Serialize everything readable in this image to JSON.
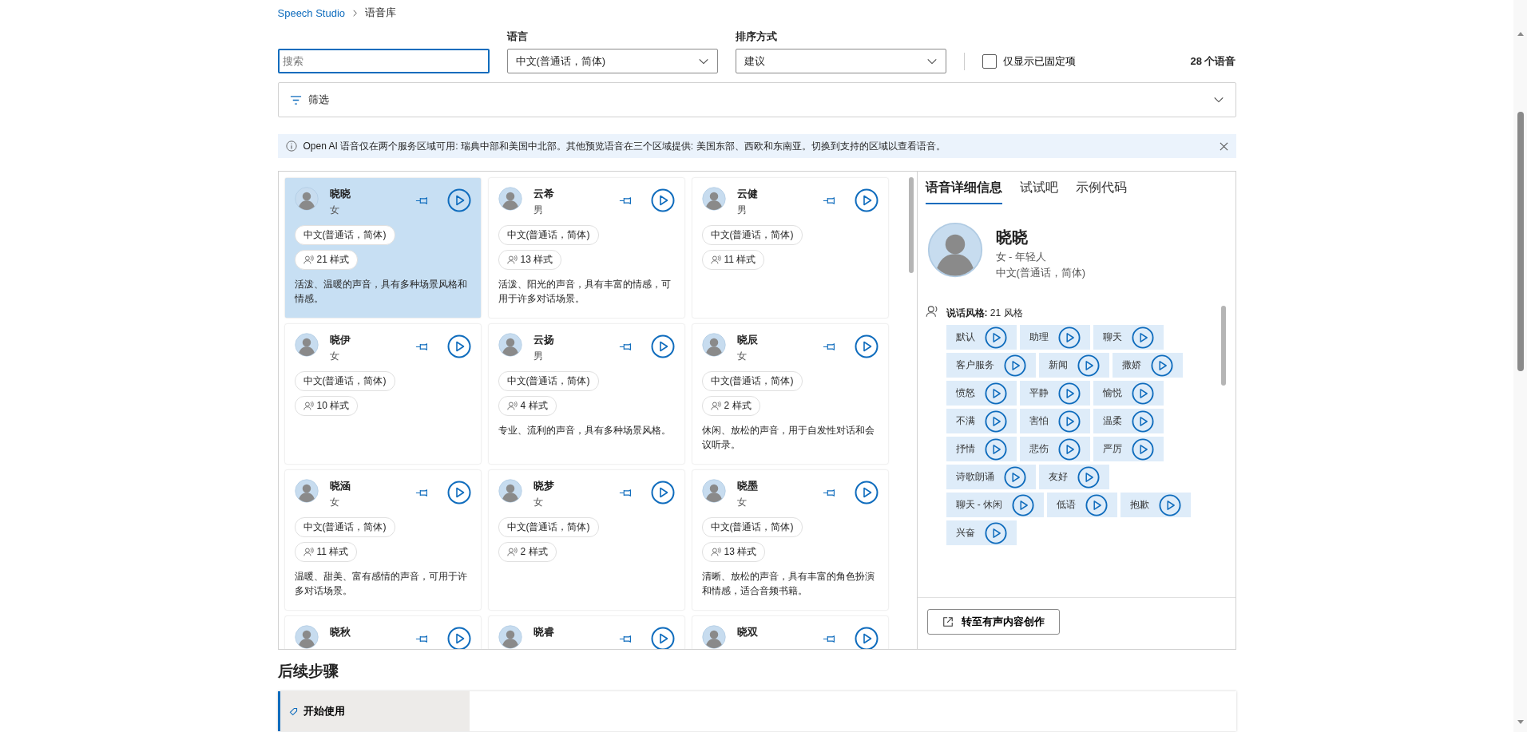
{
  "breadcrumb": [
    {
      "label": "Speech Studio",
      "kind": "link"
    },
    {
      "label": "语音库",
      "kind": "current"
    }
  ],
  "search": {
    "placeholder": "搜索"
  },
  "language_filter": {
    "label": "语言",
    "value": "中文(普通话，简体)"
  },
  "sort": {
    "label": "排序方式",
    "value": "建议"
  },
  "pinned_only": {
    "label": "仅显示已固定项",
    "checked": false
  },
  "voice_count": "28 个语音",
  "filter_panel": {
    "label": "筛选",
    "expanded": false
  },
  "info_bar": {
    "text": "Open AI 语音仅在两个服务区域可用: 瑞典中部和美国中北部。其他预览语音在三个区域提供: 美国东部、西欧和东南亚。切换到支持的区域以查看语音。"
  },
  "voices": [
    {
      "name": "晓晓",
      "gender": "女",
      "language": "中文(普通话，简体)",
      "styles": "21 样式",
      "description": "活泼、温暖的声音，具有多种场景风格和情感。",
      "selected": true
    },
    {
      "name": "云希",
      "gender": "男",
      "language": "中文(普通话，简体)",
      "styles": "13 样式",
      "description": "活泼、阳光的声音，具有丰富的情感，可用于许多对话场景。",
      "selected": false
    },
    {
      "name": "云健",
      "gender": "男",
      "language": "中文(普通话，简体)",
      "styles": "11 样式",
      "selected": false
    },
    {
      "name": "晓伊",
      "gender": "女",
      "language": "中文(普通话，简体)",
      "styles": "10 样式",
      "selected": false
    },
    {
      "name": "云扬",
      "gender": "男",
      "language": "中文(普通话，简体)",
      "styles": "4 样式",
      "description": "专业、流利的声音，具有多种场景风格。",
      "selected": false
    },
    {
      "name": "晓辰",
      "gender": "女",
      "language": "中文(普通话，简体)",
      "styles": "2 样式",
      "description": "休闲、放松的声音，用于自发性对话和会议听录。",
      "selected": false
    },
    {
      "name": "晓涵",
      "gender": "女",
      "language": "中文(普通话，简体)",
      "styles": "11 样式",
      "description": "温暖、甜美、富有感情的声音，可用于许多对话场景。",
      "selected": false
    },
    {
      "name": "晓梦",
      "gender": "女",
      "language": "中文(普通话，简体)",
      "styles": "2 样式",
      "selected": false
    },
    {
      "name": "晓墨",
      "gender": "女",
      "language": "中文(普通话，简体)",
      "styles": "13 样式",
      "description": "清晰、放松的声音，具有丰富的角色扮演和情感，适合音频书籍。",
      "selected": false
    },
    {
      "name": "晓秋",
      "selected": false
    },
    {
      "name": "晓睿",
      "selected": false
    },
    {
      "name": "晓双",
      "selected": false
    }
  ],
  "details": {
    "tabs": [
      {
        "label": "语音详细信息",
        "selected": true
      },
      {
        "label": "试试吧",
        "selected": false
      },
      {
        "label": "示例代码",
        "selected": false
      }
    ],
    "name": "晓晓",
    "gender_age": "女 - 年轻人",
    "language": "中文(普通话，简体)",
    "styles_heading": "**说话风格:** 21 风格",
    "styles": [
      "默认",
      "助理",
      "聊天",
      "客户服务",
      "新闻",
      "撒娇",
      "愤怒",
      "平静",
      "愉悦",
      "不满",
      "害怕",
      "温柔",
      "抒情",
      "悲伤",
      "严厉",
      "诗歌朗诵",
      "友好",
      "聊天 - 休闲",
      "低语",
      "抱歉",
      "兴奋"
    ],
    "create_button": "转至有声内容创作"
  },
  "next_steps": {
    "title": "后续步骤",
    "tabs": [
      {
        "label": "开始使用",
        "selected": true
      }
    ]
  }
}
